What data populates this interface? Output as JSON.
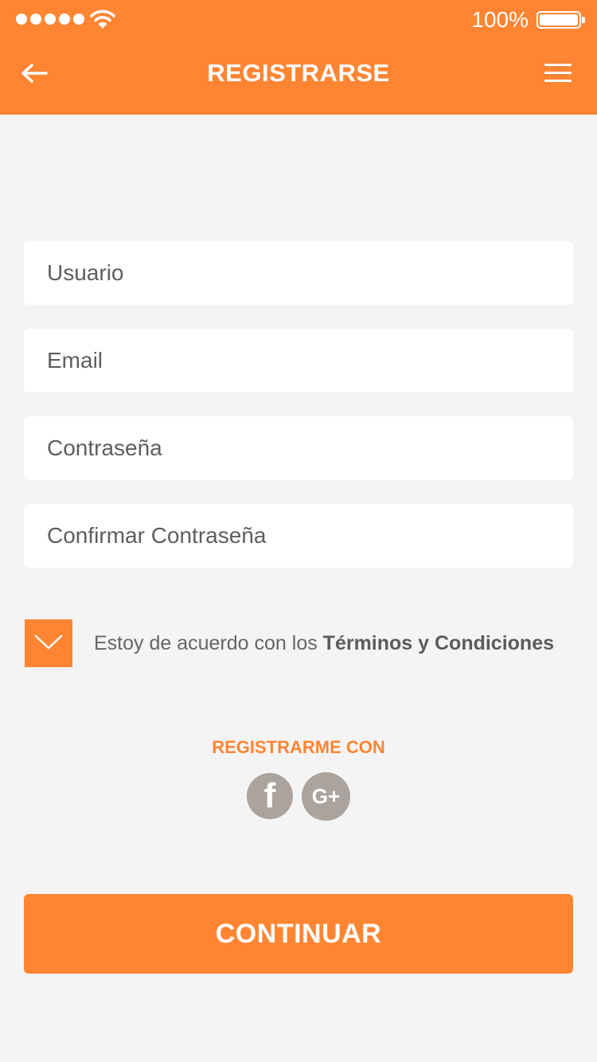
{
  "status_bar": {
    "battery_percent": "100%",
    "signal_dots": 5
  },
  "header": {
    "title": "REGISTRARSE",
    "back_icon": "arrow-left-icon",
    "menu_icon": "hamburger-menu-icon"
  },
  "form": {
    "username_placeholder": "Usuario",
    "email_placeholder": "Email",
    "password_placeholder": "Contraseña",
    "confirm_password_placeholder": "Confirmar Contraseña"
  },
  "terms": {
    "checked": true,
    "text": "Estoy de acuerdo con los ",
    "link": "Términos y Condiciones"
  },
  "social": {
    "heading": "REGISTRARME CON",
    "facebook_glyph": "f",
    "google_glyph": "G+"
  },
  "actions": {
    "continue_label": "CONTINUAR"
  },
  "colors": {
    "accent": "#ff8533",
    "background": "#f4f4f4",
    "social_icon_bg": "#aba39d"
  }
}
